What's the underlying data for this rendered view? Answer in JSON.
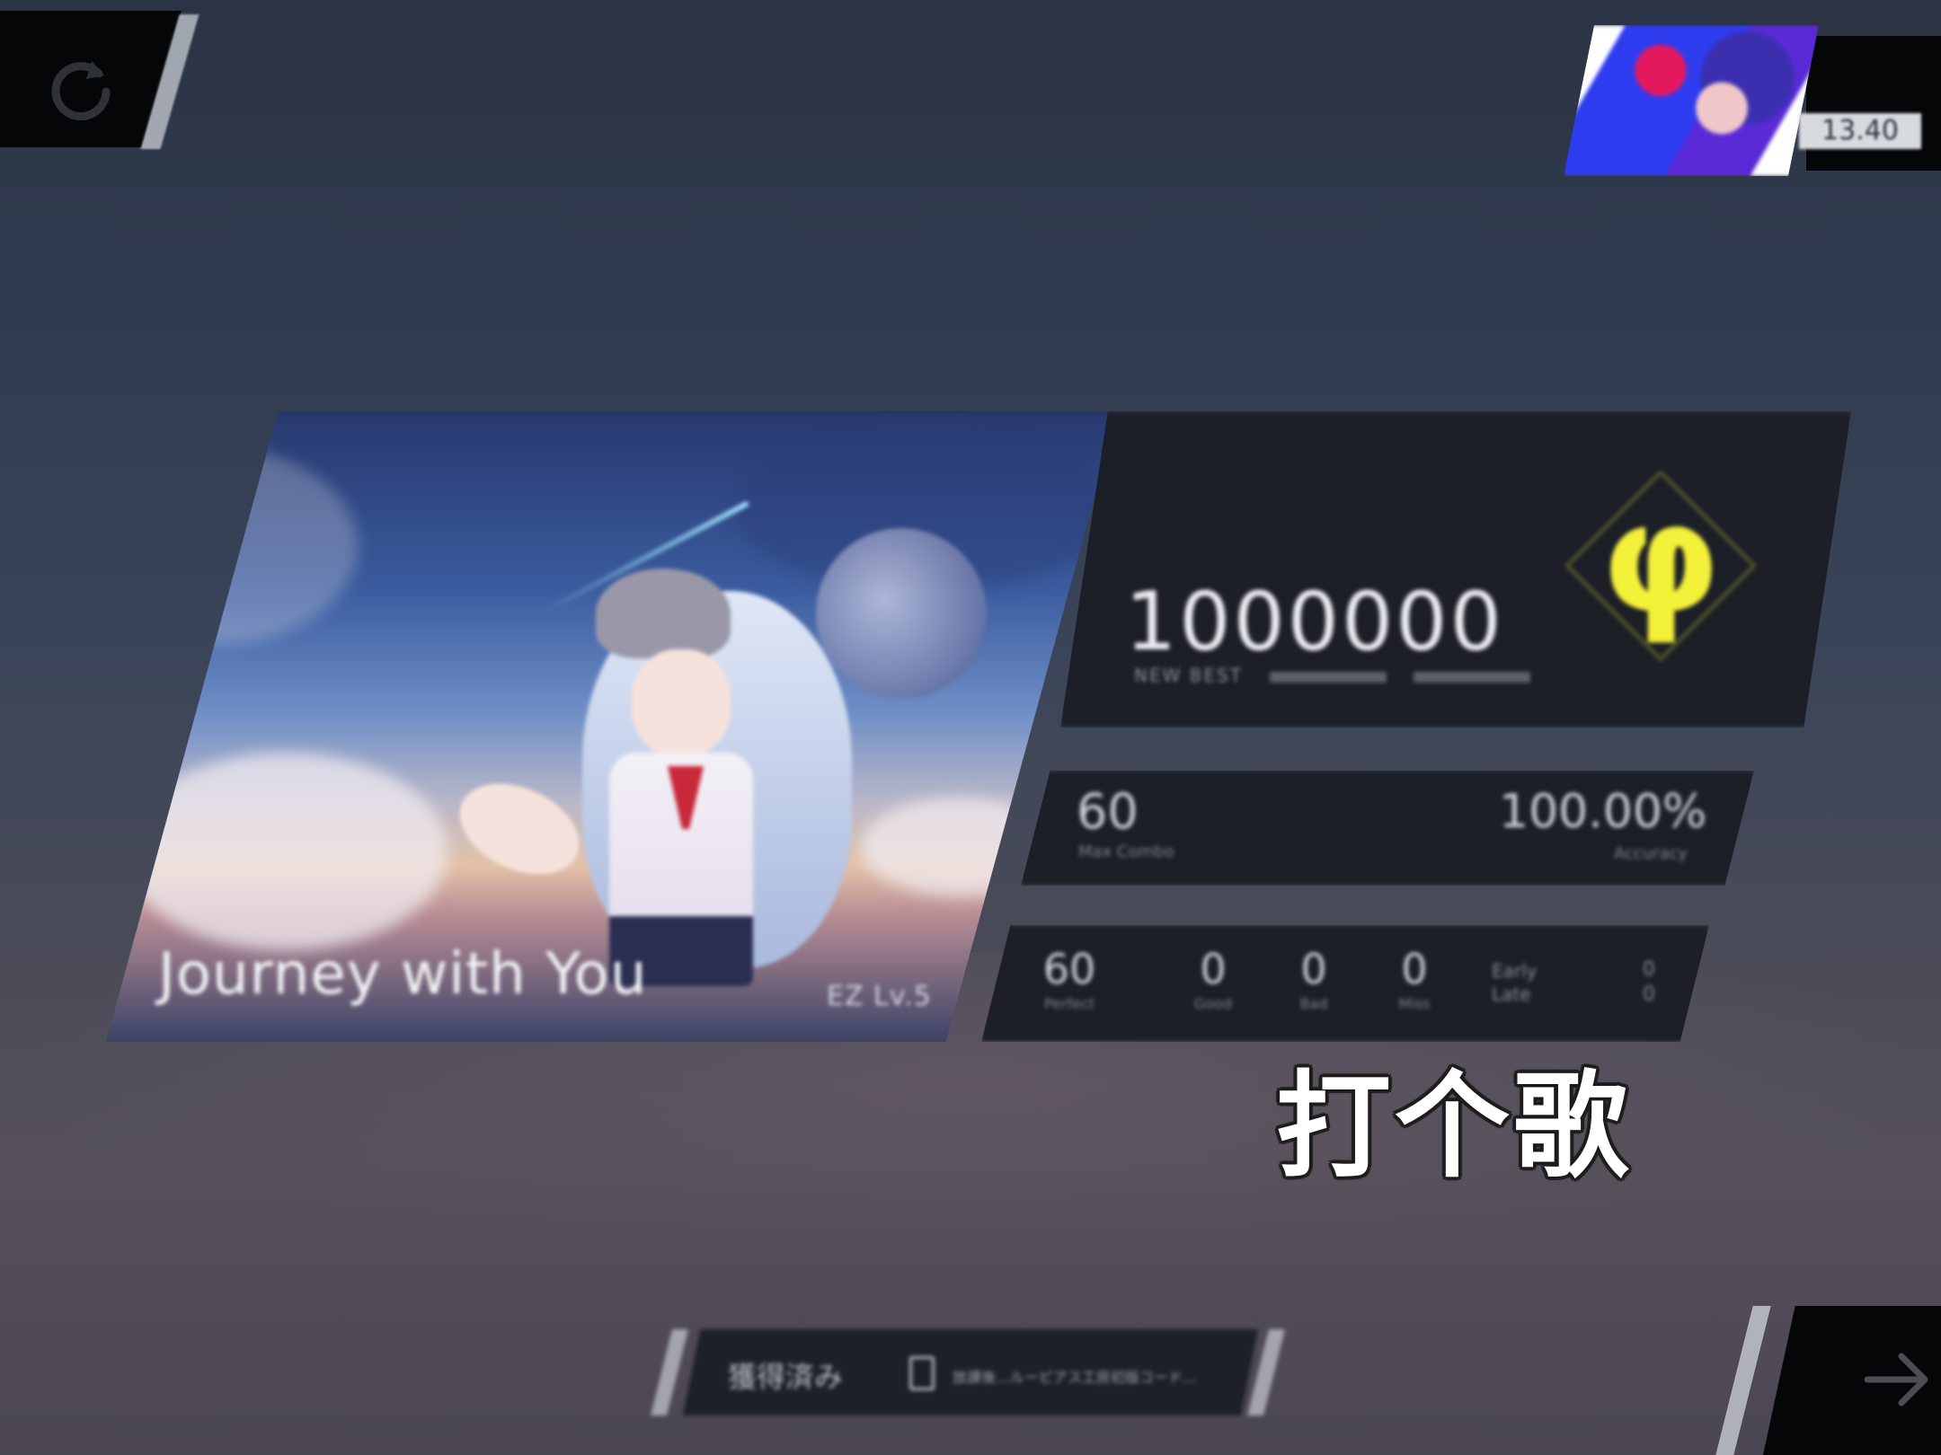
{
  "song": {
    "title": "Journey with You",
    "level": "EZ  Lv.5"
  },
  "player": {
    "rks": "13.40"
  },
  "result": {
    "score": "1000000",
    "score_subtitle": "NEW BEST",
    "grade": "φ",
    "max_combo_value": "60",
    "max_combo_label": "Max Combo",
    "accuracy_value": "100.00%",
    "accuracy_label": "Accuracy",
    "judgements": [
      {
        "label": "Perfect",
        "value": "60"
      },
      {
        "label": "Good",
        "value": "0"
      },
      {
        "label": "Bad",
        "value": "0"
      },
      {
        "label": "Miss",
        "value": "0"
      }
    ],
    "early_label": "Early",
    "late_label": "Late",
    "early_value": "0",
    "late_value": "0"
  },
  "caption": "打个歌",
  "status": {
    "label": "獲得済み",
    "link_text": "放課後…ルービアス工房初版コード…"
  },
  "colors": {
    "grade_yellow": "#f4f13a",
    "panel": "#1c1f27",
    "background": "#313b50"
  },
  "icons": {
    "retry": "retry-icon",
    "next": "arrow-right-icon",
    "document": "document-icon"
  }
}
